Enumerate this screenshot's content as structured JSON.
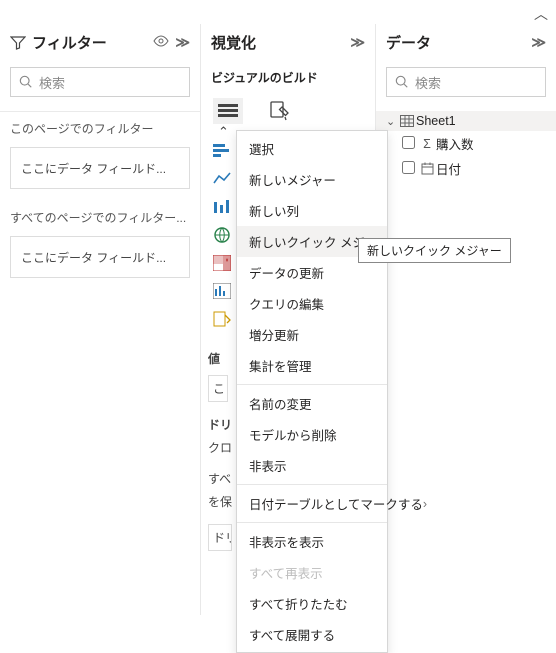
{
  "top": {
    "collapse_icon": "︿"
  },
  "filters": {
    "title": "フィルター",
    "search_placeholder": "検索",
    "page_label": "このページでのフィルター",
    "dropzone_page": "ここにデータ フィールド...",
    "all_pages_label": "すべてのページでのフィルター...",
    "dropzone_all": "ここにデータ フィールド..."
  },
  "visuals": {
    "title": "視覚化",
    "subtitle": "ビジュアルのビルド",
    "truncated": {
      "value_header": "値",
      "value_box": "こ",
      "drill_header": "ドリ",
      "cross": "クロ",
      "keep1": "すべ",
      "keep2": "を保",
      "drill_box": "ドリ"
    }
  },
  "data": {
    "title": "データ",
    "search_placeholder": "検索",
    "sheet": "Sheet1",
    "fields": [
      {
        "icon": "sigma",
        "label": "購入数"
      },
      {
        "icon": "calendar",
        "label": "日付"
      }
    ]
  },
  "menu": {
    "items": [
      {
        "label": "選択",
        "type": "item"
      },
      {
        "label": "新しいメジャー",
        "type": "item"
      },
      {
        "label": "新しい列",
        "type": "item"
      },
      {
        "label": "新しいクイック メジャー",
        "type": "item",
        "hover": true
      },
      {
        "label": "データの更新",
        "type": "item"
      },
      {
        "label": "クエリの編集",
        "type": "item"
      },
      {
        "label": "増分更新",
        "type": "item"
      },
      {
        "label": "集計を管理",
        "type": "item"
      },
      {
        "type": "sep"
      },
      {
        "label": "名前の変更",
        "type": "item"
      },
      {
        "label": "モデルから削除",
        "type": "item"
      },
      {
        "label": "非表示",
        "type": "item"
      },
      {
        "type": "sep"
      },
      {
        "label": "日付テーブルとしてマークする",
        "type": "item",
        "submenu": true
      },
      {
        "type": "sep"
      },
      {
        "label": "非表示を表示",
        "type": "item"
      },
      {
        "label": "すべて再表示",
        "type": "item",
        "disabled": true
      },
      {
        "label": "すべて折りたたむ",
        "type": "item"
      },
      {
        "label": "すべて展開する",
        "type": "item"
      }
    ]
  },
  "tooltip": "新しいクイック メジャー"
}
